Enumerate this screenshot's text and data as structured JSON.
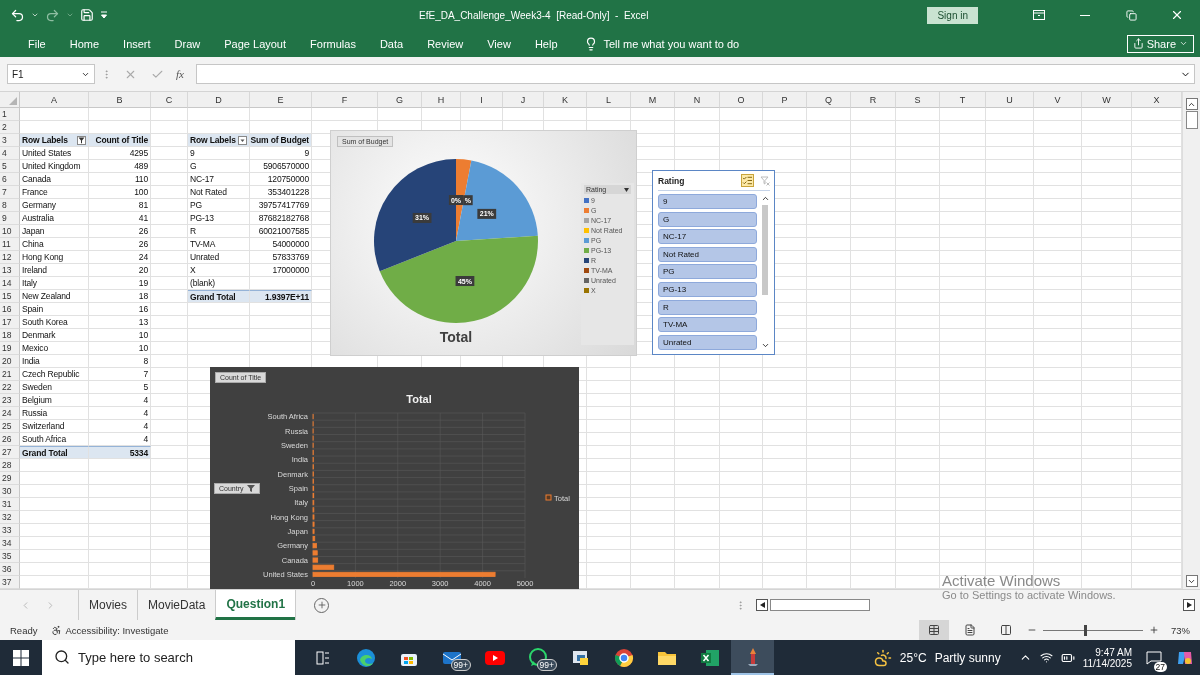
{
  "title_bar": {
    "title": "EfE_DA_Challenge_Week3-4  [Read-Only]  -  Excel",
    "sign_in": "Sign in"
  },
  "ribbon": {
    "tabs": [
      "File",
      "Home",
      "Insert",
      "Draw",
      "Page Layout",
      "Formulas",
      "Data",
      "Review",
      "View",
      "Help"
    ],
    "tell_me": "Tell me what you want to do",
    "share": "Share"
  },
  "formula_bar": {
    "name_box": "F1",
    "fx": "fx"
  },
  "sheet": {
    "columns": [
      "A",
      "B",
      "C",
      "D",
      "E",
      "F",
      "G",
      "H",
      "I",
      "J",
      "K",
      "L",
      "M",
      "N",
      "O",
      "P",
      "Q",
      "R",
      "S",
      "T",
      "U",
      "V",
      "W",
      "X"
    ],
    "rows": [
      "1",
      "2",
      "3",
      "4",
      "5",
      "6",
      "7",
      "8",
      "9",
      "10",
      "11",
      "12",
      "13",
      "14",
      "15",
      "16",
      "17",
      "18",
      "19",
      "20",
      "21",
      "22",
      "23",
      "24",
      "25",
      "26",
      "27",
      "28",
      "29",
      "30",
      "31",
      "32",
      "33",
      "34",
      "35",
      "36",
      "37"
    ]
  },
  "pivot_country": {
    "filtered": true,
    "header": [
      "Row Labels",
      "Count of Title"
    ],
    "rows": [
      [
        "United States",
        "4295"
      ],
      [
        "United Kingdom",
        "489"
      ],
      [
        "Canada",
        "110"
      ],
      [
        "France",
        "100"
      ],
      [
        "Germany",
        "81"
      ],
      [
        "Australia",
        "41"
      ],
      [
        "Japan",
        "26"
      ],
      [
        "China",
        "26"
      ],
      [
        "Hong Kong",
        "24"
      ],
      [
        "Ireland",
        "20"
      ],
      [
        "Italy",
        "19"
      ],
      [
        "New Zealand",
        "18"
      ],
      [
        "Spain",
        "16"
      ],
      [
        "South Korea",
        "13"
      ],
      [
        "Denmark",
        "10"
      ],
      [
        "Mexico",
        "10"
      ],
      [
        "India",
        "8"
      ],
      [
        "Czech Republic",
        "7"
      ],
      [
        "Sweden",
        "5"
      ],
      [
        "Belgium",
        "4"
      ],
      [
        "Russia",
        "4"
      ],
      [
        "Switzerland",
        "4"
      ],
      [
        "South Africa",
        "4"
      ]
    ],
    "total": [
      "Grand Total",
      "5334"
    ]
  },
  "pivot_rating": {
    "filtered": false,
    "header": [
      "Row Labels",
      "Sum of Budget"
    ],
    "rows": [
      [
        "9",
        "9"
      ],
      [
        "G",
        "5906570000"
      ],
      [
        "NC-17",
        "120750000"
      ],
      [
        "Not Rated",
        "353401228"
      ],
      [
        "PG",
        "39757417769"
      ],
      [
        "PG-13",
        "87682182768"
      ],
      [
        "R",
        "60021007585"
      ],
      [
        "TV-MA",
        "54000000"
      ],
      [
        "Unrated",
        "57833769"
      ],
      [
        "X",
        "17000000"
      ],
      [
        "(blank)"
      ]
    ],
    "total": [
      "Grand Total",
      "1.9397E+11"
    ]
  },
  "pie_chart": {
    "field_button": "Sum of Budget",
    "legend_button": "Rating",
    "chart_data": {
      "type": "pie",
      "legend": "right",
      "categories": [
        "9",
        "G",
        "NC-17",
        "Not Rated",
        "PG",
        "PG-13",
        "R",
        "TV-MA",
        "Unrated",
        "X"
      ],
      "series": [
        {
          "name": "Total",
          "values": [
            0,
            3,
            0,
            0,
            21,
            45,
            31,
            0,
            0,
            0
          ]
        }
      ],
      "colors": [
        "#4472c4",
        "#ed7d31",
        "#a5a5a5",
        "#ffc000",
        "#5b9bd5",
        "#70ad47",
        "#264478",
        "#9e480e",
        "#636363",
        "#997300"
      ],
      "value_labels": [
        "0%",
        "%",
        null,
        null,
        "21%",
        "45%",
        "31%",
        null,
        null,
        null
      ]
    }
  },
  "slicer": {
    "title": "Rating",
    "items": [
      {
        "label": "9",
        "selected": true
      },
      {
        "label": "G",
        "selected": true
      },
      {
        "label": "NC-17",
        "selected": true
      },
      {
        "label": "Not Rated",
        "selected": true
      },
      {
        "label": "PG",
        "selected": true
      },
      {
        "label": "PG-13",
        "selected": true
      },
      {
        "label": "R",
        "selected": true
      },
      {
        "label": "TV-MA",
        "selected": true
      },
      {
        "label": "Unrated",
        "selected": true
      }
    ]
  },
  "bar_chart": {
    "field_button": "Count of Title",
    "axis_button": "Country",
    "chart_data": {
      "type": "bar",
      "orientation": "horizontal",
      "title": "Total",
      "legend": "right",
      "grid": true,
      "categories": [
        "South Africa",
        null,
        "Russia",
        null,
        "Sweden",
        null,
        "India",
        null,
        "Denmark",
        null,
        "Spain",
        null,
        "Italy",
        null,
        "Hong Kong",
        null,
        "Japan",
        null,
        "Germany",
        null,
        "Canada",
        null,
        "United States"
      ],
      "series": [
        {
          "name": "Total",
          "color": "#ed7d31",
          "values": [
            4,
            4,
            4,
            4,
            5,
            7,
            8,
            10,
            10,
            13,
            16,
            18,
            19,
            20,
            24,
            26,
            26,
            41,
            81,
            100,
            110,
            489,
            4295
          ]
        }
      ],
      "xlim": [
        0,
        5000
      ],
      "xticks": [
        0,
        1000,
        2000,
        3000,
        4000,
        5000
      ]
    }
  },
  "sheet_tabs": [
    {
      "label": "Movies",
      "selected": false
    },
    {
      "label": "MovieData",
      "selected": false
    },
    {
      "label": "Question1",
      "selected": true
    }
  ],
  "activation": {
    "title": "Activate Windows",
    "subtitle": "Go to Settings to activate Windows."
  },
  "status_bar": {
    "ready": "Ready",
    "accessibility": "Accessibility: Investigate",
    "zoom_slider": {
      "level": 0.41
    },
    "zoom": "73%"
  },
  "taskbar": {
    "search_placeholder": "Type here to search",
    "apps": [
      {
        "kind": "taskview",
        "selected": false
      },
      {
        "kind": "edge",
        "selected": false
      },
      {
        "kind": "store",
        "selected": false
      },
      {
        "kind": "mail",
        "badge": "99+",
        "selected": false
      },
      {
        "kind": "youtube",
        "selected": false
      },
      {
        "kind": "whatsapp",
        "badge": "99+",
        "selected": false
      },
      {
        "kind": "python",
        "selected": false
      },
      {
        "kind": "chrome",
        "selected": false
      },
      {
        "kind": "files",
        "selected": false
      },
      {
        "kind": "excel",
        "selected": false
      },
      {
        "kind": "tool",
        "selected": true
      }
    ],
    "temperature": "25°C",
    "weather": "Partly sunny",
    "time": "9:47 AM",
    "date": "11/14/2025",
    "notifications": "27"
  }
}
